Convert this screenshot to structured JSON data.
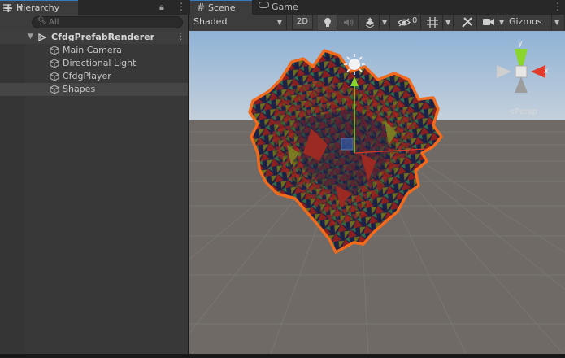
{
  "hierarchy": {
    "tab_label": "Hierarchy",
    "search_placeholder": "All",
    "root": "CfdgPrefabRenderer",
    "items": [
      {
        "label": "Main Camera"
      },
      {
        "label": "Directional Light"
      },
      {
        "label": "CfdgPlayer"
      },
      {
        "label": "Shapes"
      }
    ]
  },
  "scene": {
    "tabs": [
      {
        "label": "Scene"
      },
      {
        "label": "Game"
      }
    ],
    "draw_mode": "Shaded",
    "btn_2d": "2D",
    "hidden_count": "0",
    "gizmos": "Gizmos",
    "projection": "Persp",
    "gizmo_axis_y": "y",
    "gizmo_axis_x": "x"
  },
  "colors": {
    "accent": "#3a79bb",
    "selection_outline": "#f26b1d",
    "sky": "#b6c9dc",
    "ground": "#6f6a66"
  }
}
